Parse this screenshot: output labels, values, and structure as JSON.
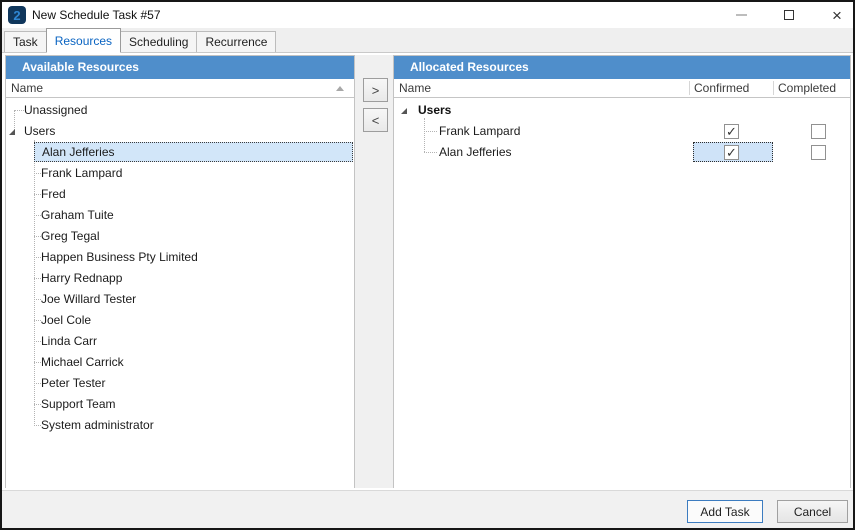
{
  "window": {
    "title": "New Schedule Task #57",
    "app_icon_glyph": "2"
  },
  "icons": {
    "close": "×",
    "check": "✓"
  },
  "tabs": [
    {
      "label": "Task",
      "active": false
    },
    {
      "label": "Resources",
      "active": true
    },
    {
      "label": "Scheduling",
      "active": false
    },
    {
      "label": "Recurrence",
      "active": false
    }
  ],
  "available": {
    "title": "Available Resources",
    "name_column": "Name",
    "sort": "ascending",
    "tree": [
      {
        "label": "Unassigned",
        "level": 0,
        "expander": false,
        "selected": false
      },
      {
        "label": "Users",
        "level": 0,
        "expander": true,
        "selected": false
      },
      {
        "label": "Alan Jefferies",
        "level": 1,
        "selected": true
      },
      {
        "label": "Frank Lampard",
        "level": 1,
        "selected": false
      },
      {
        "label": "Fred",
        "level": 1,
        "selected": false
      },
      {
        "label": "Graham Tuite",
        "level": 1,
        "selected": false
      },
      {
        "label": "Greg Tegal",
        "level": 1,
        "selected": false
      },
      {
        "label": "Happen Business Pty Limited",
        "level": 1,
        "selected": false
      },
      {
        "label": "Harry Rednapp",
        "level": 1,
        "selected": false
      },
      {
        "label": "Joe Willard Tester",
        "level": 1,
        "selected": false
      },
      {
        "label": "Joel Cole",
        "level": 1,
        "selected": false
      },
      {
        "label": "Linda Carr",
        "level": 1,
        "selected": false
      },
      {
        "label": "Michael Carrick",
        "level": 1,
        "selected": false
      },
      {
        "label": "Peter Tester",
        "level": 1,
        "selected": false
      },
      {
        "label": "Support Team",
        "level": 1,
        "selected": false
      },
      {
        "label": "System administrator",
        "level": 1,
        "selected": false
      }
    ]
  },
  "transfer": {
    "move_right": ">",
    "move_left": "<"
  },
  "allocated": {
    "title": "Allocated Resources",
    "columns": [
      "Name",
      "Confirmed",
      "Completed"
    ],
    "group": {
      "label": "Users",
      "expanded": true
    },
    "rows": [
      {
        "name": "Frank Lampard",
        "confirmed": true,
        "completed": false,
        "focused_cell": null
      },
      {
        "name": "Alan Jefferies",
        "confirmed": true,
        "completed": false,
        "focused_cell": "confirmed"
      }
    ]
  },
  "footer": {
    "add_button": "Add Task",
    "cancel_button": "Cancel"
  },
  "colors": {
    "panel_header": "#4f8ecb",
    "selection": "#d2e6f9",
    "focus_cell": "#cfe3f8",
    "active_tab_text": "#0a64c2"
  }
}
